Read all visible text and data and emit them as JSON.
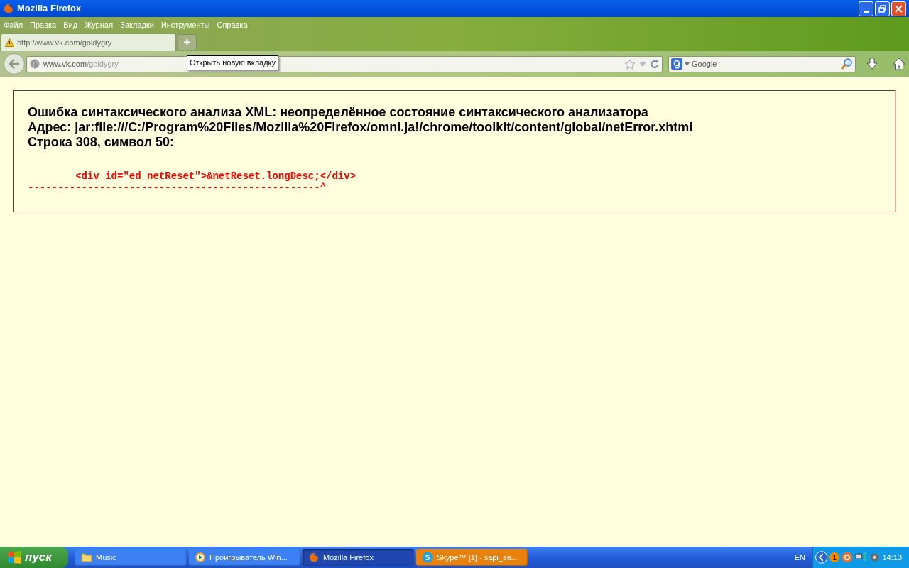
{
  "window": {
    "title": "Mozilla Firefox"
  },
  "menu": [
    "Файл",
    "Правка",
    "Вид",
    "Журнал",
    "Закладки",
    "Инструменты",
    "Справка"
  ],
  "tabs": [
    {
      "label": "http://www.vk.com/goldygry",
      "selected": true
    }
  ],
  "new_tab_tooltip": "Открыть новую вкладку",
  "address": {
    "domain": "www.vk.com",
    "path": "/goldygry"
  },
  "search": {
    "placeholder": "Google"
  },
  "error": {
    "lines": [
      "Ошибка синтаксического анализа XML: неопределённое состояние синтаксического анализатора",
      "Адрес: jar:file:///C:/Program%20Files/Mozilla%20Firefox/omni.ja!/chrome/toolkit/content/global/netError.xhtml",
      "Строка 308, символ 50:"
    ],
    "source_line": "<div id=\"ed_netReset\">&netReset.longDesc;</div>",
    "pointer_line": "-------------------------------------------------^"
  },
  "taskbar": {
    "start": "пуск",
    "items": [
      {
        "kind": "folder",
        "label": "Music",
        "selected": false,
        "attention": false
      },
      {
        "kind": "player",
        "label": "Проигрыватель Win...",
        "selected": false,
        "attention": false
      },
      {
        "kind": "firefox",
        "label": "Mozilla Firefox",
        "selected": true,
        "attention": false
      },
      {
        "kind": "skype",
        "label": "Skype™ [1] - sapi_sa...",
        "selected": false,
        "attention": true
      }
    ],
    "language": "EN",
    "badge": "1",
    "clock": "14:13"
  }
}
